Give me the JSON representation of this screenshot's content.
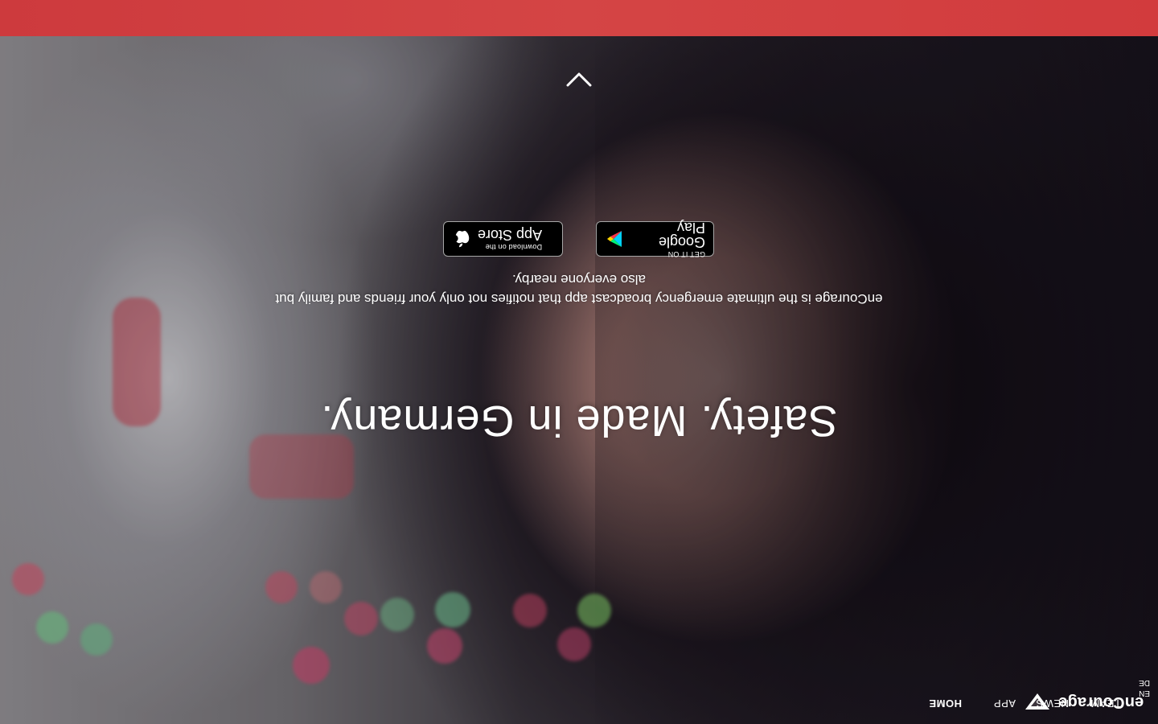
{
  "brand": {
    "name": "enCourage",
    "accent_color": "#d44545",
    "logo_icon": "encourage-logo-icon"
  },
  "nav": {
    "items": [
      {
        "label": "HOME",
        "active": true
      },
      {
        "label": "APP",
        "active": false
      },
      {
        "label": "NEWS",
        "active": false
      },
      {
        "label": "TEAM",
        "active": false
      }
    ],
    "languages": [
      "EN",
      "DE"
    ]
  },
  "hero": {
    "headline": "Safety. Made in Germany.",
    "subtitle": "enCourage is the ultimate emergency broadcast app that notifies not only your friends and family but also everyone nearby."
  },
  "badges": {
    "app_store": {
      "small": "Download on the",
      "big": "App Store",
      "icon": "apple-icon"
    },
    "google_play": {
      "small": "GET IT ON",
      "big": "Google Play",
      "icon": "google-play-icon"
    }
  },
  "scroll_icon": "chevron-down-icon",
  "page_orientation": "rotated-180"
}
